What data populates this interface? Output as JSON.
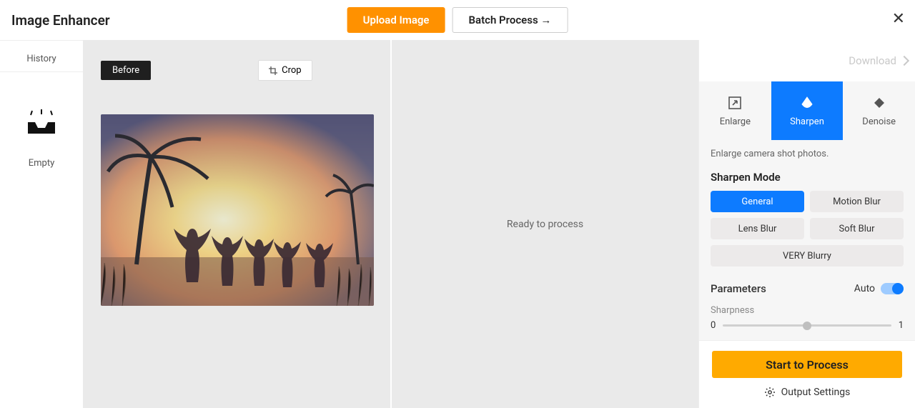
{
  "header": {
    "title": "Image Enhancer",
    "upload": "Upload Image",
    "batch": "Batch Process →"
  },
  "sidebar": {
    "history": "History",
    "empty": "Empty"
  },
  "workspace": {
    "before": "Before",
    "crop": "Crop",
    "ready": "Ready to process"
  },
  "right": {
    "download": "Download",
    "tabs": {
      "enlarge": "Enlarge",
      "sharpen": "Sharpen",
      "denoise": "Denoise"
    },
    "desc": "Enlarge camera shot photos.",
    "mode_title": "Sharpen Mode",
    "modes": {
      "general": "General",
      "motion": "Motion Blur",
      "lens": "Lens Blur",
      "soft": "Soft Blur",
      "very": "VERY Blurry"
    },
    "params_title": "Parameters",
    "auto": "Auto",
    "sharpness_label": "Sharpness",
    "sharpness_min": "0",
    "sharpness_max": "1",
    "start": "Start to Process",
    "output": "Output Settings"
  }
}
